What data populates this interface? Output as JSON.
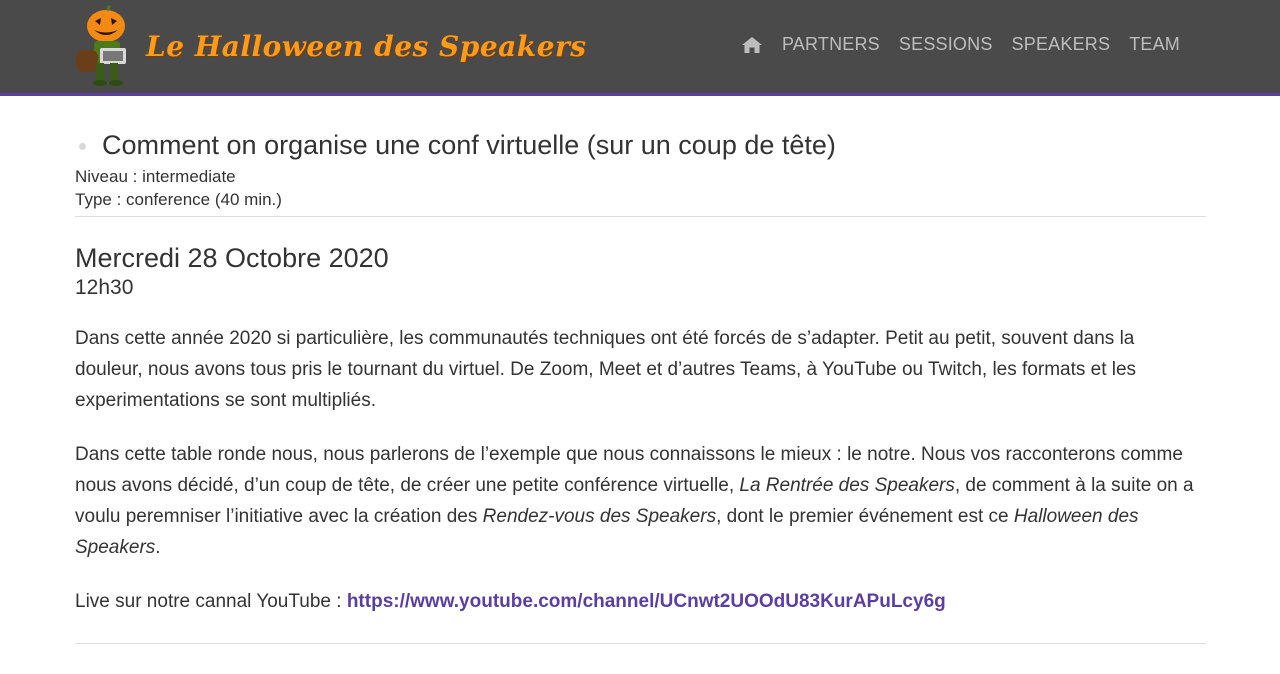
{
  "brand": {
    "logo_text": "Le Halloween des Speakers",
    "text_color": "#ff9a1a"
  },
  "nav": {
    "home_icon": "home-icon",
    "items": [
      "PARTNERS",
      "SESSIONS",
      "SPEAKERS",
      "TEAM"
    ]
  },
  "session": {
    "title": "Comment on organise une conf virtuelle (sur un coup de tête)",
    "level": "Niveau : intermediate",
    "type": "Type : conference (40 min.)",
    "date": "Mercredi 28 Octobre 2020",
    "time": "12h30",
    "paragraph1": "Dans cette année 2020 si particulière, les communautés techniques ont été forcés de s’adapter. Petit au petit, souvent dans la douleur, nous avons tous pris le tournant du virtuel. De Zoom, Meet et d’autres Teams, à YouTube ou Twitch, les formats et les experimentations se sont multipliés.",
    "paragraph2": {
      "part1": "Dans cette table ronde nous, nous parlerons de l’exemple que nous connaissons le mieux : le notre. Nous vos racconterons comme nous avons décidé, d’un coup de tête, de créer une petite conférence virtuelle, ",
      "em1": "La Rentrée des Speakers",
      "part2": ", de comment à la suite on a voulu peremniser l’initiative avec la création des ",
      "em2": "Rendez-vous des Speakers",
      "part3": ", dont le premier événement est ce ",
      "em3": "Halloween des Speakers",
      "part4": "."
    },
    "live_label": "Live sur notre cannal YouTube : ",
    "live_url": "https://www.youtube.com/channel/UCnwt2UOOdU83KurAPuLcy6g"
  },
  "colors": {
    "navbar_bg": "#4a4a4a",
    "accent": "#5b3fa0",
    "nav_text": "#bdbdbd"
  }
}
